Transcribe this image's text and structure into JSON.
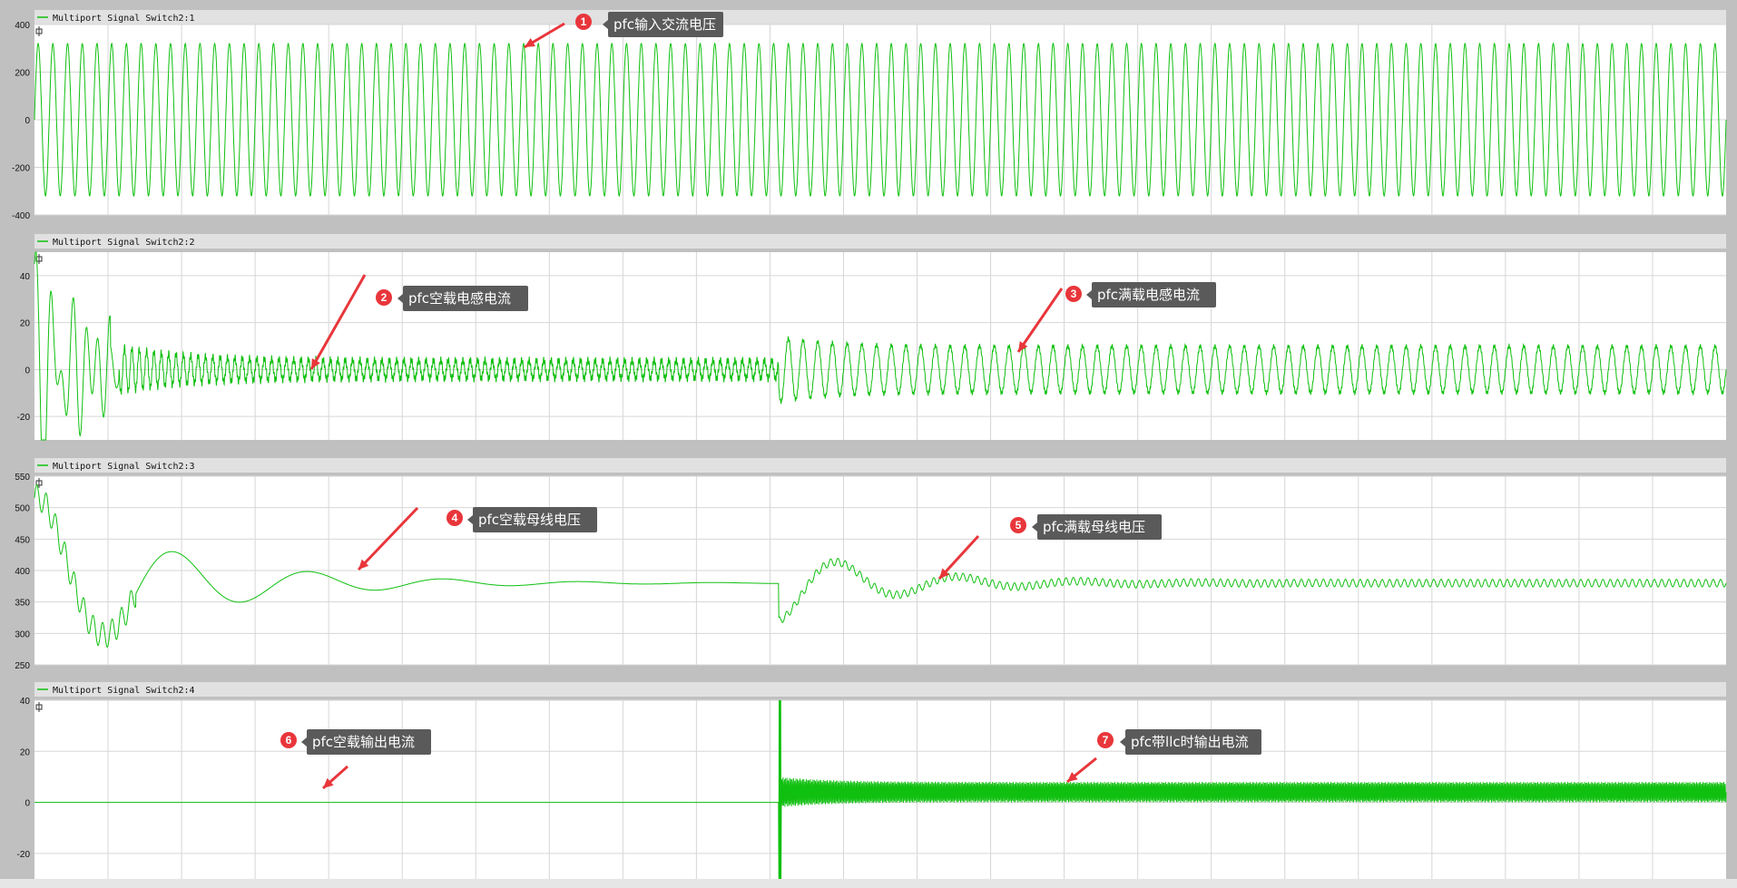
{
  "chart_data": [
    {
      "type": "line",
      "title": "Multiport Signal Switch2:1",
      "series": [
        {
          "name": "Multiport Signal Switch2:1",
          "color": "#10c010"
        }
      ],
      "ylim": [
        -400,
        400
      ],
      "yticks": [
        "400",
        "200",
        "0",
        "-200",
        "-400"
      ],
      "grid": true,
      "signal": {
        "kind": "ac_sine",
        "amplitude": 320,
        "cycles": 115
      },
      "annotations": [
        {
          "num": "1",
          "label": "pfc输入交流电压"
        }
      ]
    },
    {
      "type": "line",
      "title": "Multiport Signal Switch2:2",
      "series": [
        {
          "name": "Multiport Signal Switch2:2",
          "color": "#10c010"
        }
      ],
      "ylim": [
        -30,
        50
      ],
      "yticks": [
        "40",
        "20",
        "0",
        "-20"
      ],
      "grid": true,
      "signal": {
        "kind": "inductor_current",
        "light_load_amplitude": 4,
        "full_load_amplitude": 10,
        "load_step_fraction": 0.44
      },
      "annotations": [
        {
          "num": "2",
          "label": "pfc空载电感电流"
        },
        {
          "num": "3",
          "label": "pfc满载电感电流"
        }
      ]
    },
    {
      "type": "line",
      "title": "Multiport Signal Switch2:3",
      "series": [
        {
          "name": "Multiport Signal Switch2:3",
          "color": "#10c010"
        }
      ],
      "ylim": [
        250,
        550
      ],
      "yticks": [
        "550",
        "500",
        "450",
        "400",
        "350",
        "300",
        "250"
      ],
      "grid": true,
      "signal": {
        "kind": "bus_voltage",
        "steady": 380,
        "initial_peak": 520,
        "load_step_fraction": 0.44
      },
      "annotations": [
        {
          "num": "4",
          "label": "pfc空载母线电压"
        },
        {
          "num": "5",
          "label": "pfc满载母线电压"
        }
      ]
    },
    {
      "type": "line",
      "title": "Multiport Signal Switch2:4",
      "series": [
        {
          "name": "Multiport Signal Switch2:4",
          "color": "#10c010"
        }
      ],
      "ylim": [
        -30,
        40
      ],
      "yticks": [
        "40",
        "20",
        "0",
        "-20"
      ],
      "grid": true,
      "signal": {
        "kind": "output_current",
        "idle": 0,
        "spike_high": 40,
        "spike_low": -30,
        "steady_band": [
          0,
          8
        ],
        "load_step_fraction": 0.44
      },
      "annotations": [
        {
          "num": "6",
          "label": "pfc空载输出电流"
        },
        {
          "num": "7",
          "label": "pfc带llc时输出电流"
        }
      ]
    }
  ]
}
